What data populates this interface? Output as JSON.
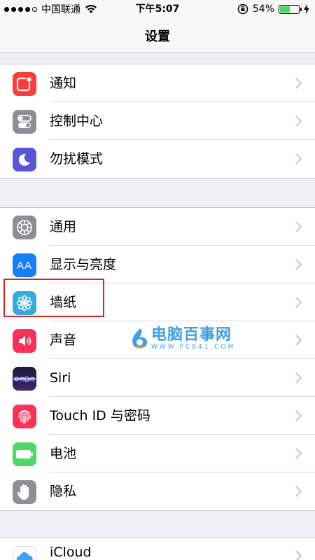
{
  "status_bar": {
    "carrier": "中国联通",
    "time": "下午5:07",
    "battery_percent": "54%",
    "battery_level": 0.54
  },
  "nav": {
    "title": "设置"
  },
  "groups": [
    {
      "items": [
        {
          "label": "通知",
          "icon": "notifications-icon",
          "color": "#fc3d39"
        },
        {
          "label": "控制中心",
          "icon": "control-center-icon",
          "color": "#8e8e93"
        },
        {
          "label": "勿扰模式",
          "icon": "do-not-disturb-icon",
          "color": "#5856d6"
        }
      ]
    },
    {
      "items": [
        {
          "label": "通用",
          "icon": "gear-icon",
          "color": "#8e8e93"
        },
        {
          "label": "显示与亮度",
          "icon": "display-brightness-icon",
          "color": "#147efb",
          "icon_text": "AA"
        },
        {
          "label": "墙纸",
          "icon": "wallpaper-icon",
          "color": "#35aadc"
        },
        {
          "label": "声音",
          "icon": "sound-icon",
          "color": "#fc3158"
        },
        {
          "label": "Siri",
          "icon": "siri-icon",
          "color": "#1c1c3a"
        },
        {
          "label": "Touch ID 与密码",
          "icon": "fingerprint-icon",
          "color": "#fc3158"
        },
        {
          "label": "电池",
          "icon": "battery-icon",
          "color": "#4cd964"
        },
        {
          "label": "隐私",
          "icon": "privacy-hand-icon",
          "color": "#8e8e93"
        }
      ]
    },
    {
      "items": [
        {
          "label": "iCloud",
          "icon": "icloud-icon",
          "color": "#ffffff"
        }
      ]
    }
  ],
  "watermark": {
    "text": "电脑百事网",
    "url": "WWW.PC841.COM"
  }
}
